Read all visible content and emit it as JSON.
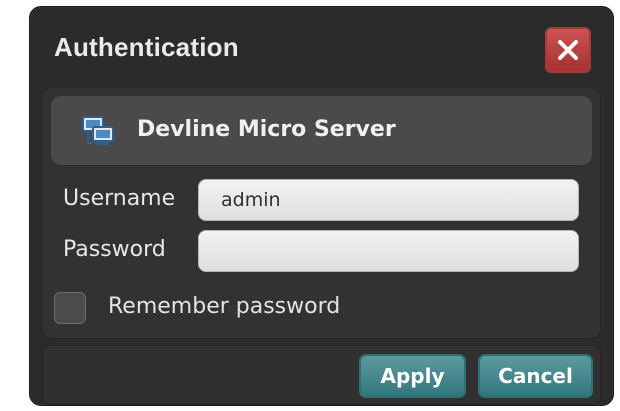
{
  "dialog": {
    "title": "Authentication",
    "close_icon": "close-icon",
    "server": {
      "icon": "network-computers-icon",
      "name": "Devline Micro Server"
    },
    "fields": {
      "username_label": "Username",
      "username_value": "admin",
      "password_label": "Password",
      "password_value": ""
    },
    "remember": {
      "label": "Remember password",
      "checked": false
    },
    "buttons": {
      "apply_label": "Apply",
      "cancel_label": "Cancel"
    },
    "colors": {
      "dialog_bg": "#2b2b2b",
      "close_button": "#b63c3c",
      "primary_button": "#32767d",
      "field_bg": "#e6e6e6"
    }
  }
}
